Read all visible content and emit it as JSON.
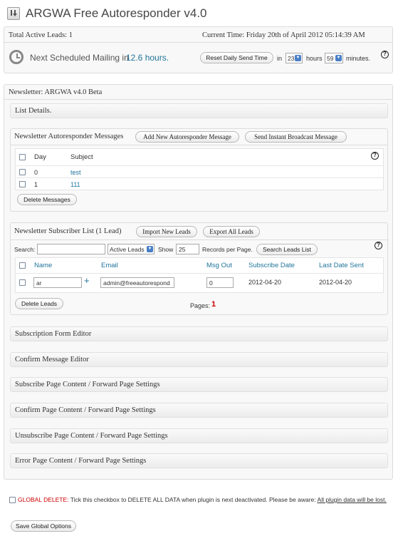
{
  "header": {
    "title": "ARGWA Free Autoresponder v4.0"
  },
  "stats": {
    "total_leads": "Total Active Leads: 1",
    "current_time": "Current Time: Friday 20th of April 2012 05:14:39 AM",
    "next_mailing_label": "Next Scheduled Mailing in",
    "next_mailing_value": "12.6 hours.",
    "reset_button": "Reset Daily Send Time",
    "in_label": "in",
    "hours_value": "23",
    "hours_label": "hours",
    "minutes_value": "59",
    "minutes_label": "minutes."
  },
  "newsletter": {
    "title": "Newsletter: ARGWA v4.0 Beta"
  },
  "list_details": "List Details.",
  "autoresponder": {
    "title": "Newsletter Autoresponder Messages",
    "add_button": "Add New Autoresponder Message",
    "broadcast_button": "Send Instant Broadcast Message",
    "col_day": "Day",
    "col_subject": "Subject",
    "rows": [
      {
        "day": "0",
        "subject": "test"
      },
      {
        "day": "1",
        "subject": "111"
      }
    ],
    "delete_button": "Delete Messages"
  },
  "subscribers": {
    "title": "Newsletter Subscriber List (1 Lead)",
    "import_button": "Import New Leads",
    "export_button": "Export All Leads",
    "search_label": "Search:",
    "search_value": "",
    "filter_value": "Active Leads",
    "show_label": "Show",
    "show_value": "25",
    "records_label": "Records per Page.",
    "search_button": "Search Leads List",
    "col_name": "Name",
    "col_email": "Email",
    "col_msgout": "Msg Out",
    "col_subscribe": "Subscribe Date",
    "col_last": "Last Date Sent",
    "row": {
      "name": "ar",
      "plus": "+",
      "email": "admin@freeautorespond",
      "msgout": "0",
      "subscribe_date": "2012-04-20",
      "last_date": "2012-04-20"
    },
    "delete_button": "Delete Leads",
    "pages_label": "Pages:",
    "page_number": "1"
  },
  "sections": [
    "Subscription Form Editor",
    "Confirm Message Editor",
    "Subscribe Page Content / Forward Page Settings",
    "Confirm Page Content / Forward Page Settings",
    "Unsubscribe Page Content / Forward Page Settings",
    "Error Page Content / Forward Page Settings"
  ],
  "global_delete": {
    "label": "GLOBAL DELETE:",
    "text": "Tick this checkbox to DELETE ALL DATA when plugin is next deactivated. Please be aware:",
    "warning": "All plugin data will be lost."
  },
  "save_button": "Save Global Options",
  "colors": {
    "link": "#21759b",
    "accent_red": "#d54e21",
    "warning_red": "#cc0000"
  }
}
